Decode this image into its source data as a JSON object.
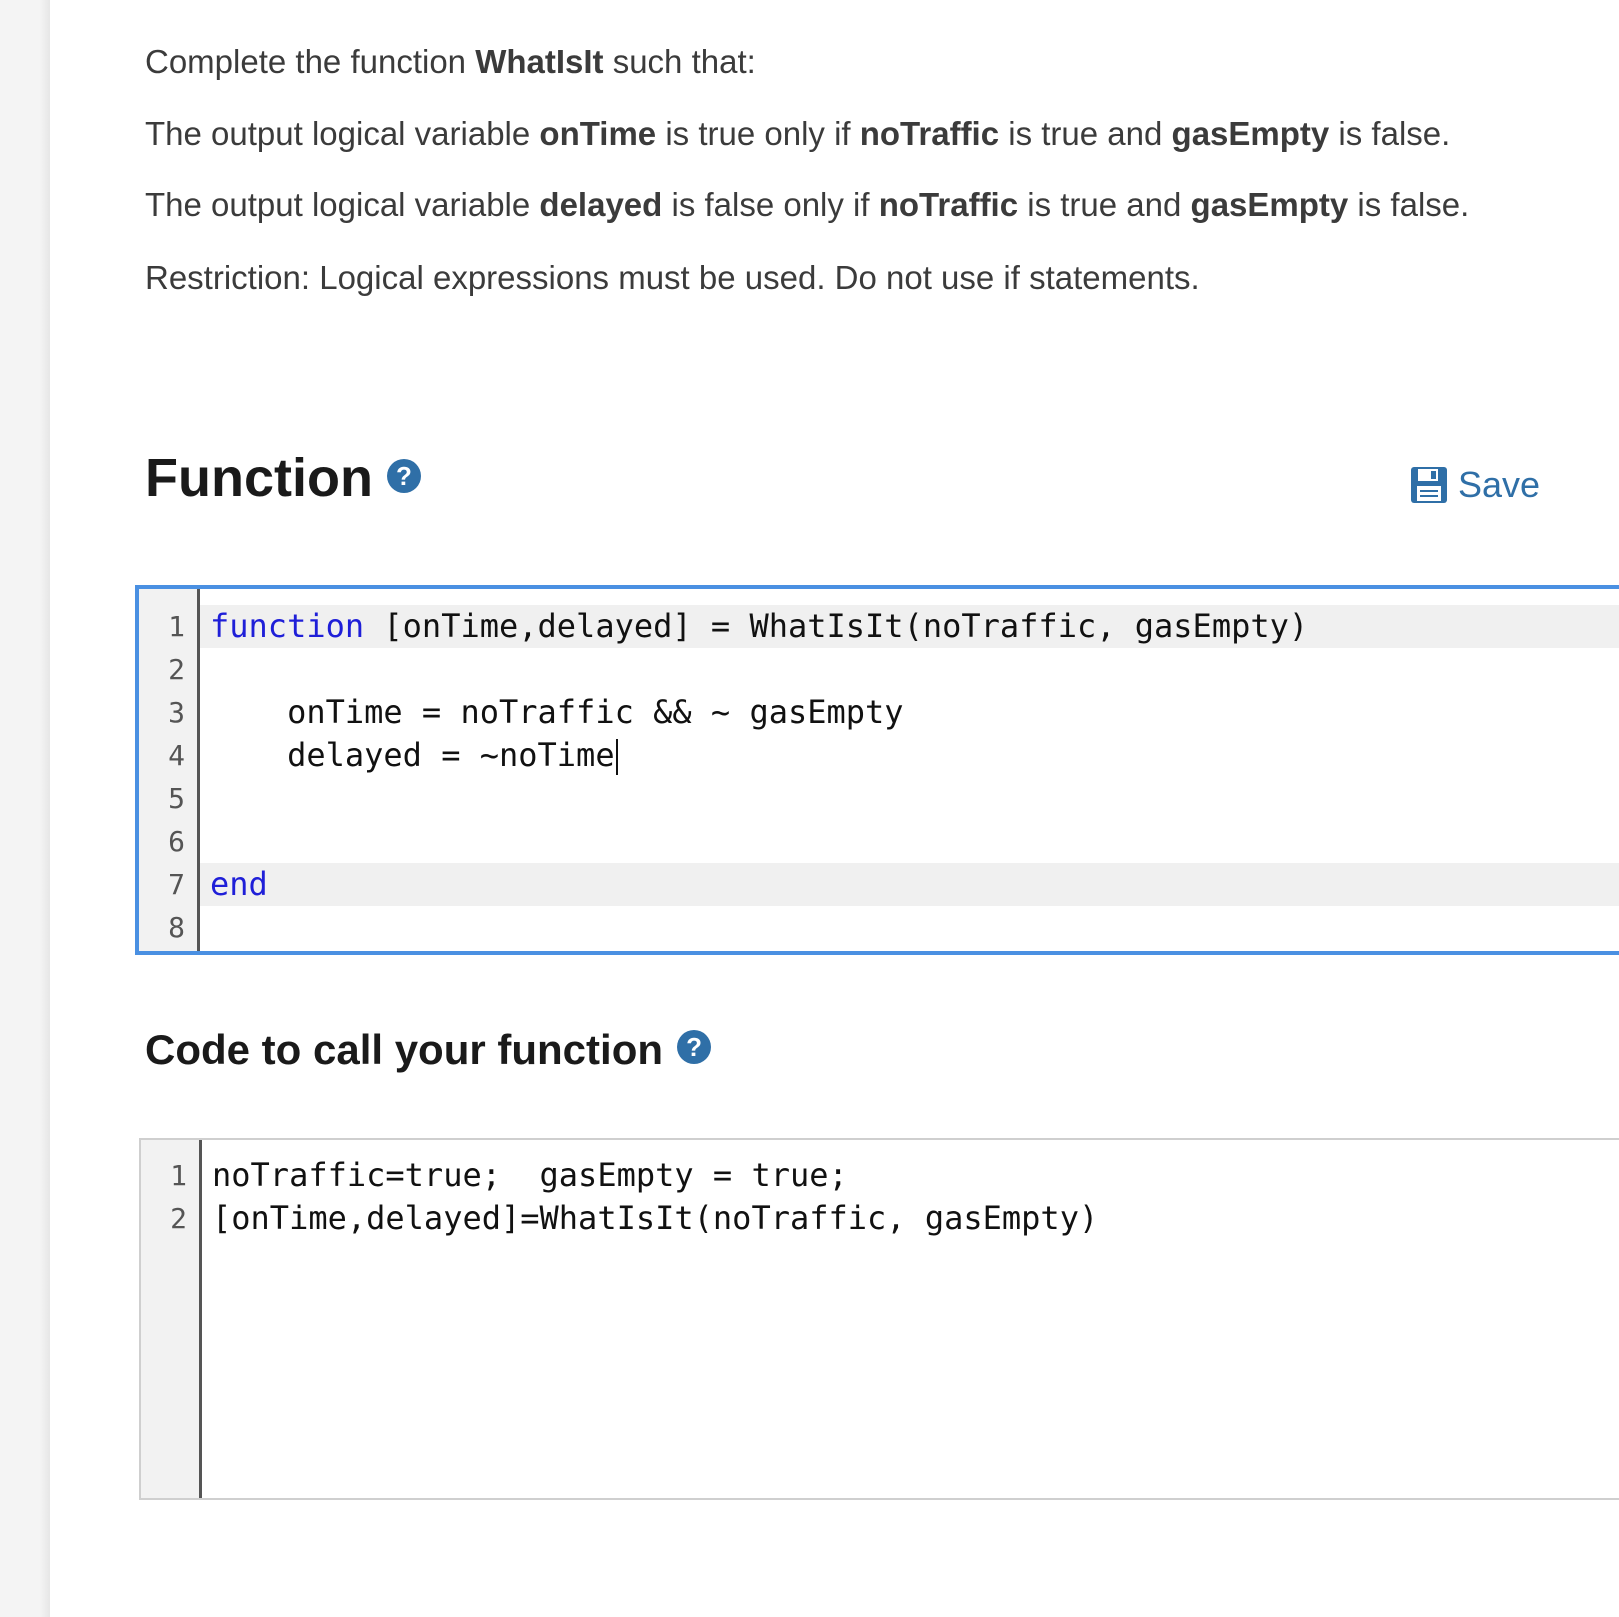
{
  "description": {
    "line1": {
      "pre": "Complete the function ",
      "bold": "WhatIsIt",
      "post": " such that:"
    },
    "line2": {
      "p1": "The output logical variable ",
      "b1": "onTime",
      "p2": " is true only if ",
      "b2": "noTraffic",
      "p3": " is true and ",
      "b3": "gasEmpty",
      "p4": " is false."
    },
    "line3": {
      "p1": "The output logical variable ",
      "b1": "delayed",
      "p2": " is false only if ",
      "b2": "noTraffic",
      "p3": " is true and ",
      "b3": "gasEmpty",
      "p4": " is false."
    },
    "line4": "Restriction:  Logical expressions must be used.  Do not use if statements."
  },
  "function_section": {
    "title": "Function",
    "help_icon": "?",
    "save_label": "Save",
    "save_icon": "floppy-disk-icon",
    "accent_color": "#2f6fa7",
    "editor": {
      "line_numbers": [
        "1",
        "2",
        "3",
        "4",
        "5",
        "6",
        "7",
        "8"
      ],
      "lines": {
        "l1_kw": "function",
        "l1_rest": " [onTime,delayed] = WhatIsIt(noTraffic, gasEmpty)",
        "l2": "",
        "l3": "    onTime = noTraffic && ~ gasEmpty",
        "l4": "    delayed = ~noTime",
        "l5": "",
        "l6": "",
        "l7_kw": "end",
        "l8": ""
      }
    }
  },
  "call_section": {
    "title": "Code to call your function",
    "help_icon": "?",
    "editor": {
      "line_numbers": [
        "1",
        "2"
      ],
      "lines": {
        "l1": "noTraffic=true;  gasEmpty = true;",
        "l2": "[onTime,delayed]=WhatIsIt(noTraffic, gasEmpty)"
      }
    }
  }
}
